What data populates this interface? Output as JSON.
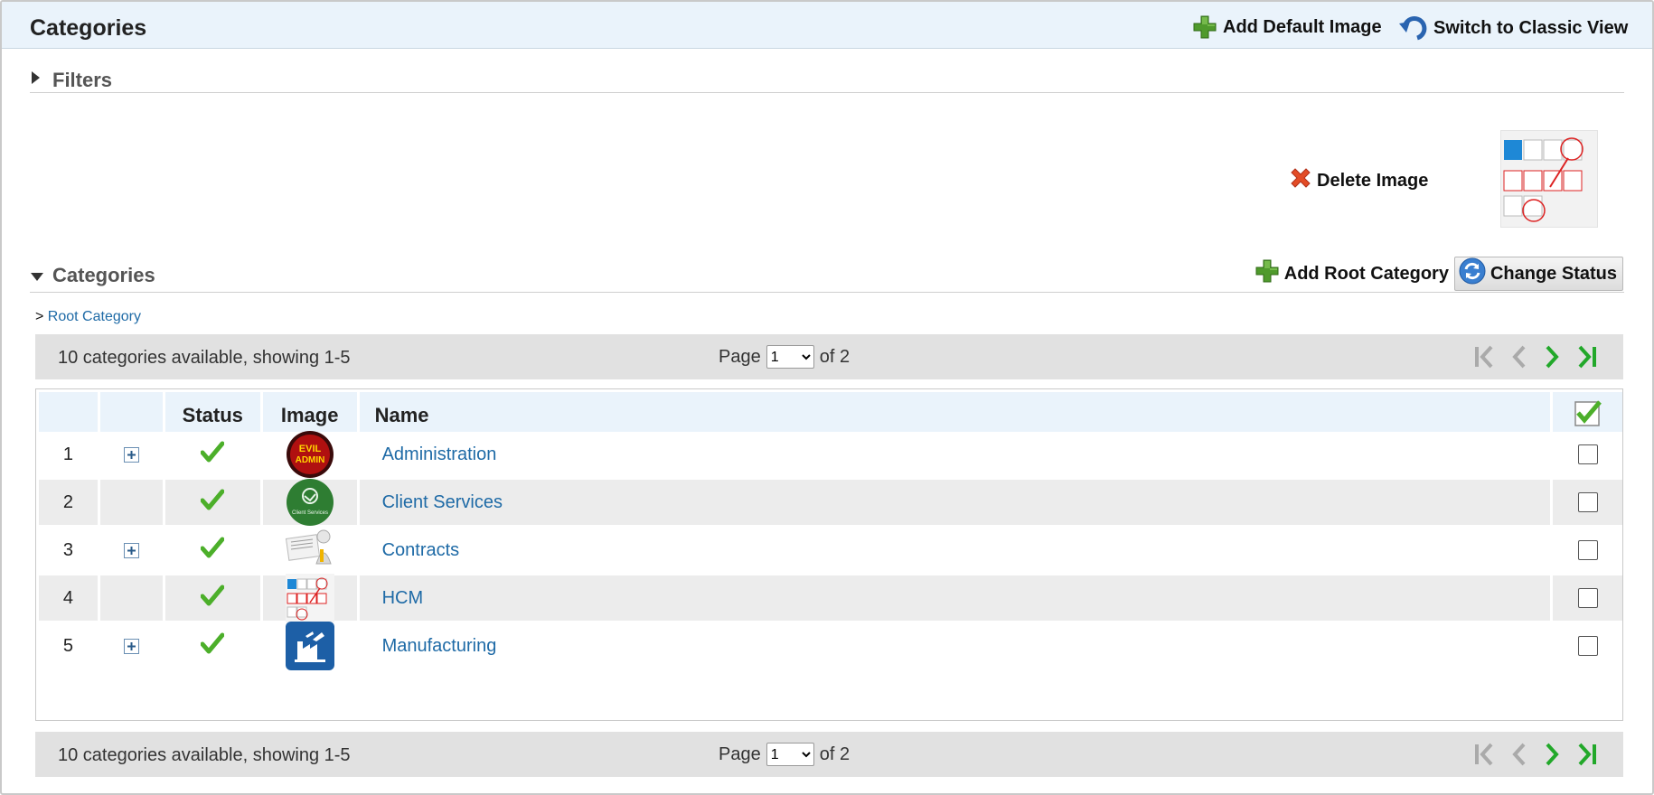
{
  "header": {
    "title": "Categories",
    "add_default_image": "Add Default Image",
    "switch_classic": "Switch to Classic View"
  },
  "filters": {
    "title": "Filters"
  },
  "image_area": {
    "delete_label": "Delete Image"
  },
  "categories_section": {
    "title": "Categories",
    "add_root": "Add Root Category",
    "change_status": "Change Status"
  },
  "breadcrumb": {
    "sep": ">",
    "root": "Root Category"
  },
  "pager": {
    "count_text": "10 categories available, showing 1-5",
    "page_label": "Page",
    "page_value": "1",
    "of_label": "of 2"
  },
  "table": {
    "headers": {
      "status": "Status",
      "image": "Image",
      "name": "Name"
    },
    "rows": [
      {
        "num": "1",
        "name": "Administration",
        "expandable": true,
        "image": "evil-admin-icon",
        "image_text": [
          "EVIL",
          "ADMIN"
        ]
      },
      {
        "num": "2",
        "name": "Client Services",
        "expandable": false,
        "image": "client-services-icon",
        "image_text": [
          "Client Services"
        ]
      },
      {
        "num": "3",
        "name": "Contracts",
        "expandable": true,
        "image": "contracts-icon"
      },
      {
        "num": "4",
        "name": "HCM",
        "expandable": false,
        "image": "hcm-screenshot-icon"
      },
      {
        "num": "5",
        "name": "Manufacturing",
        "expandable": true,
        "image": "factory-icon"
      }
    ]
  },
  "colors": {
    "header_bg": "#eaf3fb",
    "link": "#1e6aa6",
    "check_green": "#4caf2a",
    "pager_bg": "#e1e1e1",
    "row_alt": "#ececec"
  }
}
